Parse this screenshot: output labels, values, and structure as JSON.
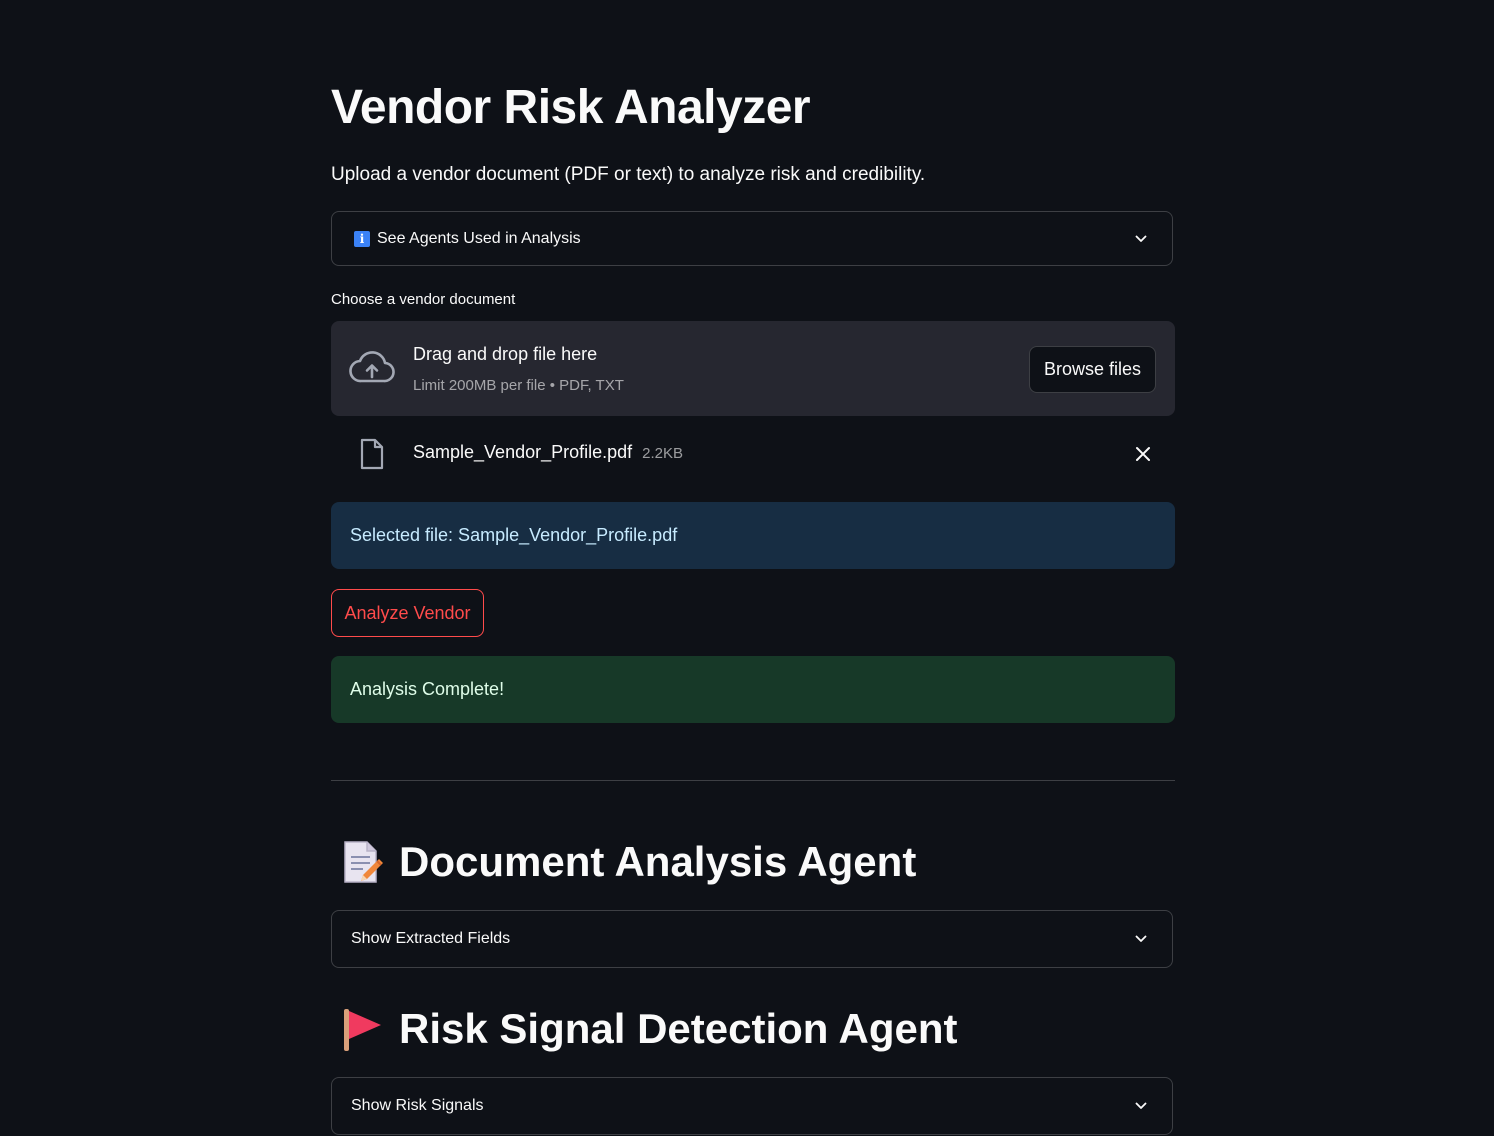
{
  "page": {
    "title": "Vendor Risk Analyzer",
    "subtitle": "Upload a vendor document (PDF or text) to analyze risk and credibility."
  },
  "agents_expander": {
    "icon": "info-icon",
    "label": "See Agents Used in Analysis"
  },
  "uploader": {
    "label": "Choose a vendor document",
    "drop_title": "Drag and drop file here",
    "limit_text": "Limit 200MB per file • PDF, TXT",
    "browse_label": "Browse files",
    "file": {
      "name": "Sample_Vendor_Profile.pdf",
      "size": "2.2KB"
    }
  },
  "selected_alert": "Selected file: Sample_Vendor_Profile.pdf",
  "analyze_button": "Analyze Vendor",
  "success_alert": "Analysis Complete!",
  "sections": {
    "document": {
      "icon": "memo-icon",
      "title": "Document Analysis Agent",
      "expander_label": "Show Extracted Fields"
    },
    "risk": {
      "icon": "red-flag-icon",
      "title": "Risk Signal Detection Agent",
      "expander_label": "Show Risk Signals"
    }
  },
  "colors": {
    "background": "#0e1117",
    "primary": "#ff4b4b",
    "info_bg": "#172d43",
    "info_text": "#c7ebff",
    "success_bg": "#173928",
    "success_text": "#dffde9",
    "dropzone_bg": "#262730"
  }
}
